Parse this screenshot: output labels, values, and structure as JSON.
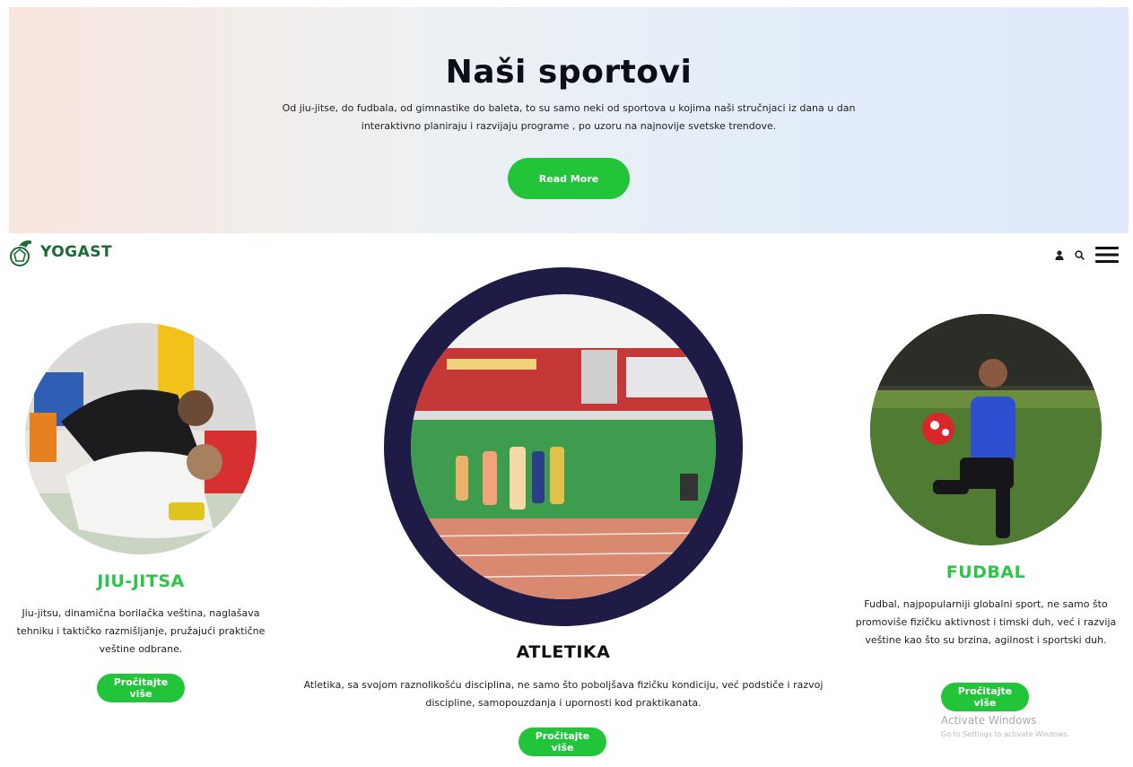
{
  "hero": {
    "title": "Naši sportovi",
    "text": "Od jiu-jitse, do fudbala, od gimnastike do baleta, to su samo neki od sportova u kojima naši stručnjaci iz dana u dan interaktivno planiraju i razvijaju programe , po uzoru na najnovije svetske trendove.",
    "button_label": "Read More"
  },
  "header": {
    "logo_text": "YOGAST",
    "icons": [
      "user-icon",
      "search-icon",
      "hamburger-menu-icon"
    ]
  },
  "cards": [
    {
      "title": "JIU-JITSA",
      "text": "Jiu-jitsu, dinamična borilačka veština, naglašava tehniku i taktičko razmišljanje, pružajući praktične veštine odbrane.",
      "button_label": "Pročitajte više"
    },
    {
      "title": "ATLETIKA",
      "text": "Atletika, sa svojom raznolikošću disciplina, ne samo što poboljšava fizičku kondiciju, već podstiče i razvoj discipline, samopouzdanja i upornosti kod praktikanata.",
      "button_label": "Pročitajte više"
    },
    {
      "title": "FUDBAL",
      "text": "Fudbal, najpopularniji globalni sport, ne samo što promoviše fizičku aktivnost i timski duh, već i razvija veštine kao što su brzina, agilnost i sportski duh.",
      "button_label": "Pročitajte više"
    }
  ],
  "watermark": {
    "title": "Activate Windows",
    "subtitle": "Go to Settings to activate Windows."
  },
  "colors": {
    "accent": "#22c43a",
    "title_green": "#2ec44a",
    "ring": "#1f1b47",
    "logo": "#1a6b36"
  }
}
